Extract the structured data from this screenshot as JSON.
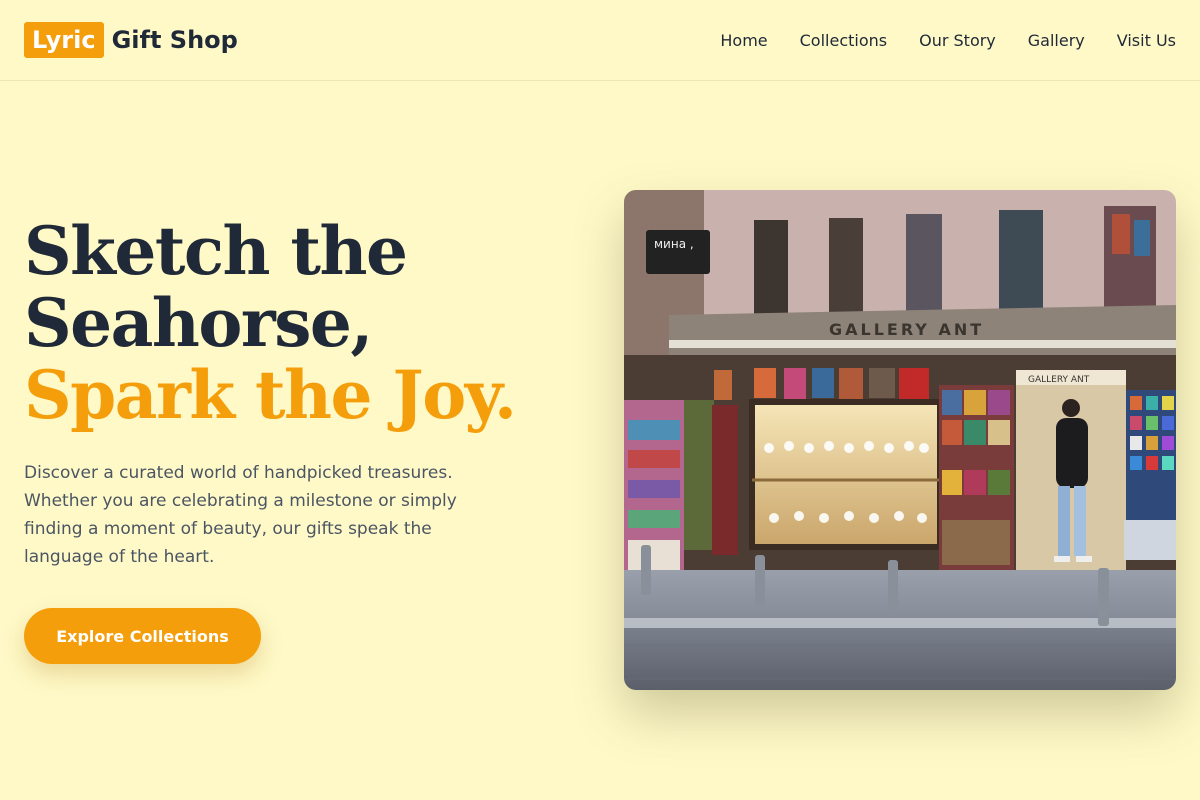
{
  "brand": {
    "badge": "Lyric",
    "name": "Gift Shop"
  },
  "nav": {
    "items": [
      {
        "label": "Home"
      },
      {
        "label": "Collections"
      },
      {
        "label": "Our Story"
      },
      {
        "label": "Gallery"
      },
      {
        "label": "Visit Us"
      }
    ]
  },
  "hero": {
    "headline_part1": "Sketch the Seahorse, ",
    "headline_part2": "Spark the Joy.",
    "description": "Discover a curated world of handpicked treasures. Whether you are celebrating a milestone or simply finding a moment of beauty, our gifts speak the language of the heart.",
    "cta_label": "Explore Collections"
  },
  "photo": {
    "store_sign": "GALLERY ANT",
    "small_sign": "мина ,",
    "door_sign": "GALLERY ANT"
  },
  "colors": {
    "background": "#fef9c7",
    "accent": "#f59e0b",
    "text": "#1f2937"
  }
}
